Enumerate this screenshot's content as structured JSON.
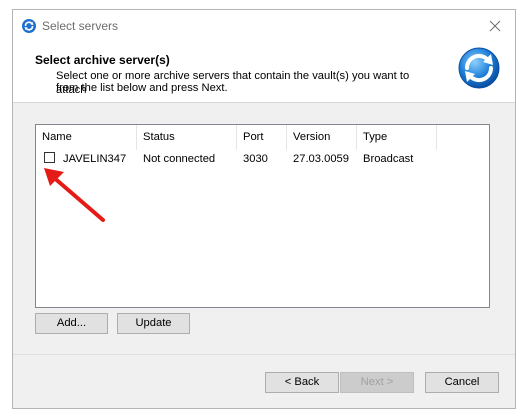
{
  "window": {
    "title": "Select servers"
  },
  "header": {
    "heading": "Select archive server(s)",
    "description_line1": "Select one or more archive servers that contain the vault(s) you want to attach",
    "description_line2": "from the list below and press Next."
  },
  "list": {
    "columns": [
      "Name",
      "Status",
      "Port",
      "Version",
      "Type"
    ],
    "rows": [
      {
        "checked": false,
        "name": "JAVELIN347",
        "status": "Not connected",
        "port": "3030",
        "version": "27.03.0059",
        "type": "Broadcast"
      }
    ]
  },
  "buttons": {
    "add": "Add...",
    "update": "Update",
    "back": "< Back",
    "next": "Next >",
    "cancel": "Cancel"
  },
  "annotation": {
    "arrow_color": "#e41b17"
  },
  "colors": {
    "dialog_bg": "#f0f0f0",
    "logo_blue": "#1e7fd8"
  },
  "icons": {
    "app": "refresh-app-icon",
    "close": "close-icon",
    "logo": "sync-arrows-logo"
  }
}
